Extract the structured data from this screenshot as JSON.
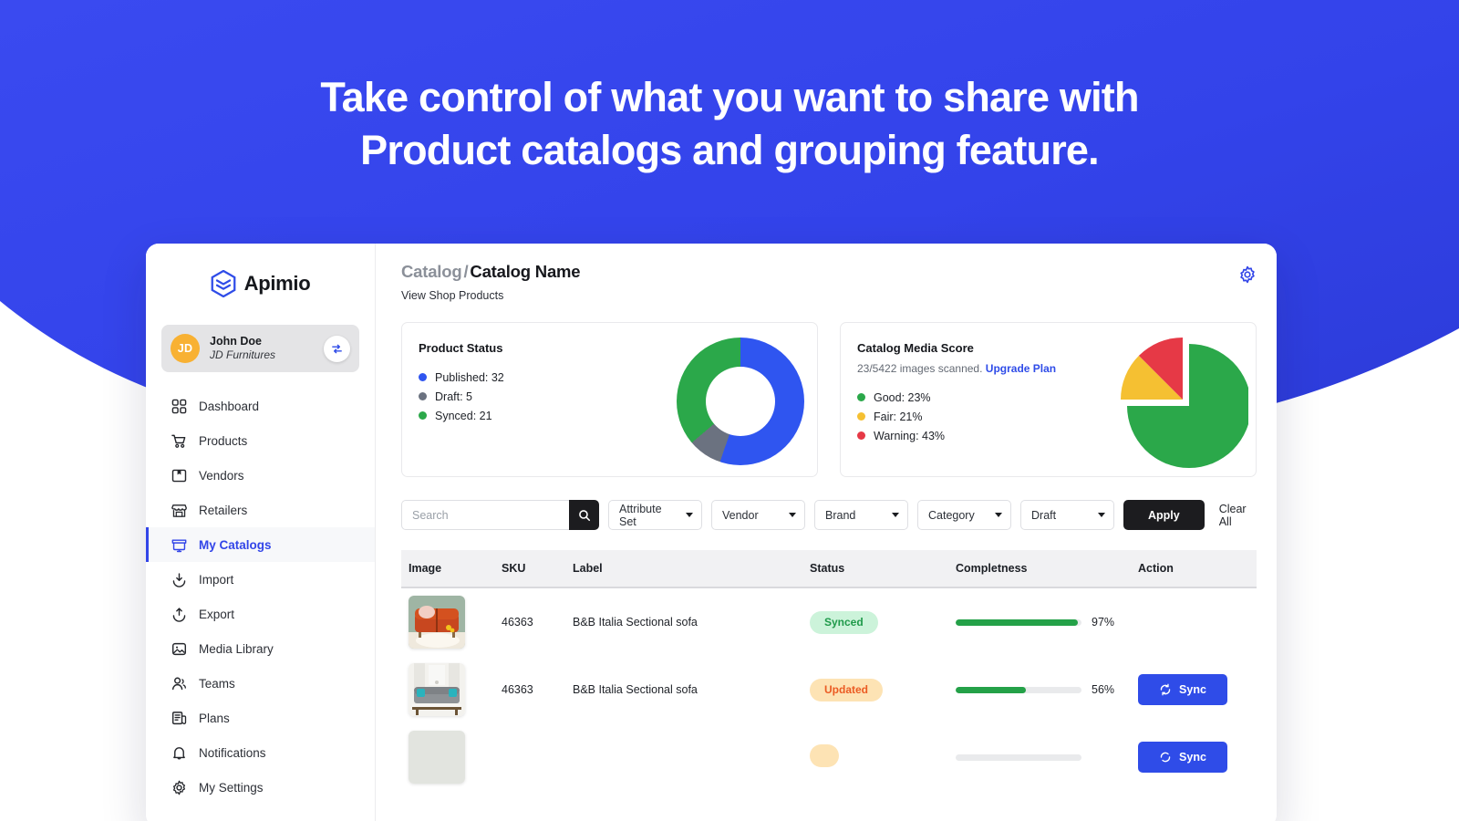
{
  "hero": {
    "line1": "Take control of what you want to share with",
    "line2": "Product catalogs and grouping feature.",
    "bg_color": "#3245e8"
  },
  "sidebar": {
    "brand": "Apimio",
    "profile": {
      "initials": "JD",
      "name": "John Doe",
      "org": "JD Furnitures",
      "switch_icon": "switch-account-icon",
      "avatar_color": "#f8b133"
    },
    "items": [
      {
        "label": "Dashboard",
        "icon": "grid-icon",
        "active": false
      },
      {
        "label": "Products",
        "icon": "cart-icon",
        "active": false
      },
      {
        "label": "Vendors",
        "icon": "box-icon",
        "active": false
      },
      {
        "label": "Retailers",
        "icon": "store-icon",
        "active": false
      },
      {
        "label": "My Catalogs",
        "icon": "catalog-icon",
        "active": true
      },
      {
        "label": "Import",
        "icon": "download-icon",
        "active": false
      },
      {
        "label": "Export",
        "icon": "upload-icon",
        "active": false
      },
      {
        "label": "Media Library",
        "icon": "image-icon",
        "active": false
      },
      {
        "label": "Teams",
        "icon": "users-icon",
        "active": false
      },
      {
        "label": "Plans",
        "icon": "billing-icon",
        "active": false
      },
      {
        "label": "Notifications",
        "icon": "bell-icon",
        "active": false
      },
      {
        "label": "My Settings",
        "icon": "gear-icon",
        "active": false
      }
    ]
  },
  "header": {
    "breadcrumb_parent": "Catalog",
    "breadcrumb_sep": "/",
    "breadcrumb_current": "Catalog Name",
    "subtitle": "View Shop Products",
    "settings_icon": "gear-icon",
    "settings_color": "#3245e8"
  },
  "cards": {
    "product_status": {
      "title": "Product Status",
      "legend": [
        {
          "label": "Published: 32",
          "color": "#2f55f0"
        },
        {
          "label": "Draft: 5",
          "color": "#6b7280"
        },
        {
          "label": "Synced: 21",
          "color": "#2ba84a"
        }
      ]
    },
    "media_score": {
      "title": "Catalog Media Score",
      "subtitle": "23/5422 images scanned.",
      "upgrade_link": "Upgrade Plan",
      "legend": [
        {
          "label": "Good: 23%",
          "color": "#2ba84a"
        },
        {
          "label": "Fair: 21%",
          "color": "#f5c032"
        },
        {
          "label": "Warning: 43%",
          "color": "#e63946"
        }
      ]
    }
  },
  "chart_data": [
    {
      "type": "pie",
      "title": "Product Status",
      "variant": "donut",
      "labels": [
        "Published",
        "Draft",
        "Synced"
      ],
      "values": [
        32,
        5,
        21
      ],
      "display_labels": [
        "Published: 32",
        "Draft: 5",
        "Synced: 21"
      ],
      "colors": [
        "#2f55f0",
        "#6b7280",
        "#2ba84a"
      ],
      "legend_position": "left",
      "units": "count"
    },
    {
      "type": "pie",
      "title": "Catalog Media Score",
      "variant": "pie-exploded",
      "labels": [
        "Good",
        "Fair",
        "Warning"
      ],
      "values": [
        23,
        21,
        43
      ],
      "display_labels": [
        "Good: 23%",
        "Fair: 21%",
        "Warning: 43%"
      ],
      "slice_angles_deg": [
        270,
        45,
        45
      ],
      "colors": [
        "#2ba84a",
        "#f5c032",
        "#e63946"
      ],
      "legend_position": "left",
      "units": "percent",
      "annotation": "23/5422 images scanned. Upgrade Plan"
    }
  ],
  "filters": {
    "search_placeholder": "Search",
    "search_value": "",
    "search_icon": "search-icon",
    "selects": [
      {
        "label": "Attribute Set"
      },
      {
        "label": "Vendor"
      },
      {
        "label": "Brand"
      },
      {
        "label": "Category"
      },
      {
        "label": "Draft"
      }
    ],
    "apply_label": "Apply",
    "clear_label": "Clear All"
  },
  "table": {
    "columns": [
      "Image",
      "SKU",
      "Label",
      "Status",
      "Completness",
      "Action"
    ],
    "rows": [
      {
        "sku": "46363",
        "label": "B&B Italia Sectional sofa",
        "status": "Synced",
        "status_type": "synced",
        "completeness": 97,
        "completeness_label": "97%",
        "action": null,
        "thumb": "orange-sofa"
      },
      {
        "sku": "46363",
        "label": "B&B Italia Sectional sofa",
        "status": "Updated",
        "status_type": "updated",
        "completeness": 56,
        "completeness_label": "56%",
        "action": "Sync",
        "thumb": "grey-sofa"
      },
      {
        "sku": "",
        "label": "",
        "status": "",
        "status_type": "updated",
        "completeness": 0,
        "completeness_label": "",
        "action": "Sync",
        "thumb": "plain"
      }
    ],
    "sync_icon": "sync-icon"
  }
}
